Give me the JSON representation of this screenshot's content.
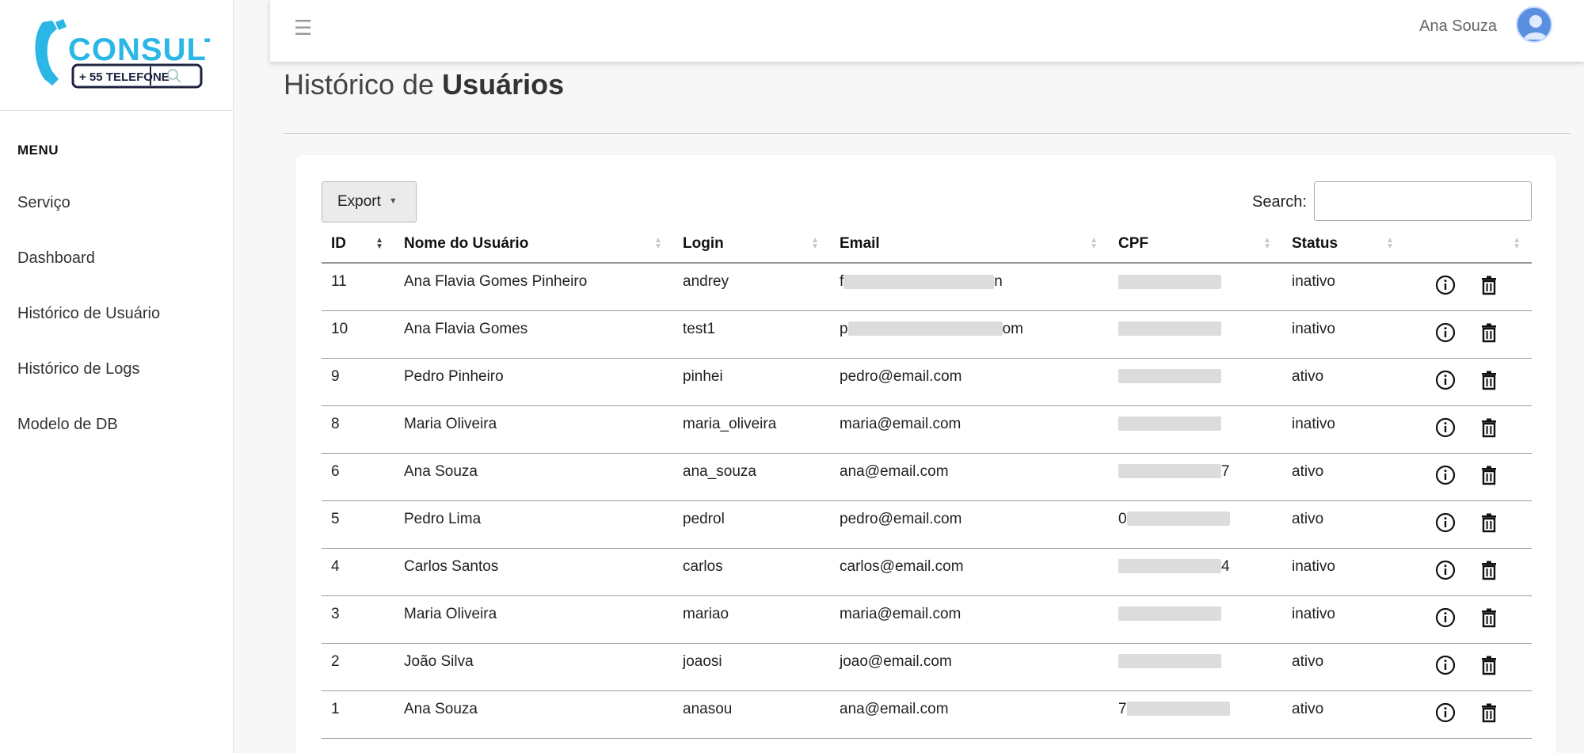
{
  "sidebar": {
    "logo": {
      "text": "CONSULTA",
      "sub_text": "+ 55 TELEFONE",
      "colors": {
        "primary": "#2bb7e6",
        "dark": "#1e2240"
      }
    },
    "menu_title": "MENU",
    "items": [
      {
        "label": "Serviço"
      },
      {
        "label": "Dashboard"
      },
      {
        "label": "Histórico de Usuário"
      },
      {
        "label": "Histórico de Logs"
      },
      {
        "label": "Modelo de DB"
      }
    ]
  },
  "header": {
    "menu_icon": "hamburger-icon",
    "user_name": "Ana Souza",
    "avatar_icon": "user-avatar-icon"
  },
  "page": {
    "title_prefix": "Histórico de ",
    "title_bold": "Usuários"
  },
  "toolbar": {
    "export_label": "Export",
    "search_label": "Search:",
    "search_value": ""
  },
  "table": {
    "columns": [
      "ID",
      "Nome do Usuário",
      "Login",
      "Email",
      "CPF",
      "Status",
      ""
    ],
    "rows": [
      {
        "id": "11",
        "name": "Ana Flavia Gomes Pinheiro",
        "login": "andrey",
        "email_prefix": "f",
        "email_mid": "",
        "email_suffix": "n",
        "cpf_prefix": "",
        "cpf_suffix": "",
        "status": "inativo"
      },
      {
        "id": "10",
        "name": "Ana Flavia Gomes",
        "login": "test1",
        "email_prefix": "p",
        "email_mid": "",
        "email_suffix": "om",
        "cpf_prefix": "",
        "cpf_suffix": "",
        "status": "inativo"
      },
      {
        "id": "9",
        "name": "Pedro Pinheiro",
        "login": "pinhei",
        "email": "pedro@email.com",
        "cpf_prefix": "",
        "cpf_suffix": "",
        "status": "ativo"
      },
      {
        "id": "8",
        "name": "Maria Oliveira",
        "login": "maria_oliveira",
        "email": "maria@email.com",
        "cpf_prefix": "",
        "cpf_suffix": "",
        "status": "inativo"
      },
      {
        "id": "6",
        "name": "Ana Souza",
        "login": "ana_souza",
        "email": "ana@email.com",
        "cpf_prefix": "",
        "cpf_suffix": "7",
        "status": "ativo"
      },
      {
        "id": "5",
        "name": "Pedro Lima",
        "login": "pedrol",
        "email": "pedro@email.com",
        "cpf_prefix": "0",
        "cpf_suffix": "",
        "status": "ativo"
      },
      {
        "id": "4",
        "name": "Carlos Santos",
        "login": "carlos",
        "email": "carlos@email.com",
        "cpf_prefix": "",
        "cpf_suffix": "4",
        "status": "inativo"
      },
      {
        "id": "3",
        "name": "Maria Oliveira",
        "login": "mariao",
        "email": "maria@email.com",
        "cpf_prefix": "",
        "cpf_suffix": "",
        "status": "inativo"
      },
      {
        "id": "2",
        "name": "João Silva",
        "login": "joaosi",
        "email": "joao@email.com",
        "cpf_prefix": "",
        "cpf_suffix": "",
        "status": "ativo"
      },
      {
        "id": "1",
        "name": "Ana Souza",
        "login": "anasou",
        "email": "ana@email.com",
        "cpf_prefix": "7",
        "cpf_suffix": "",
        "status": "ativo"
      }
    ],
    "row_actions": [
      "info-icon",
      "trash-icon"
    ]
  }
}
